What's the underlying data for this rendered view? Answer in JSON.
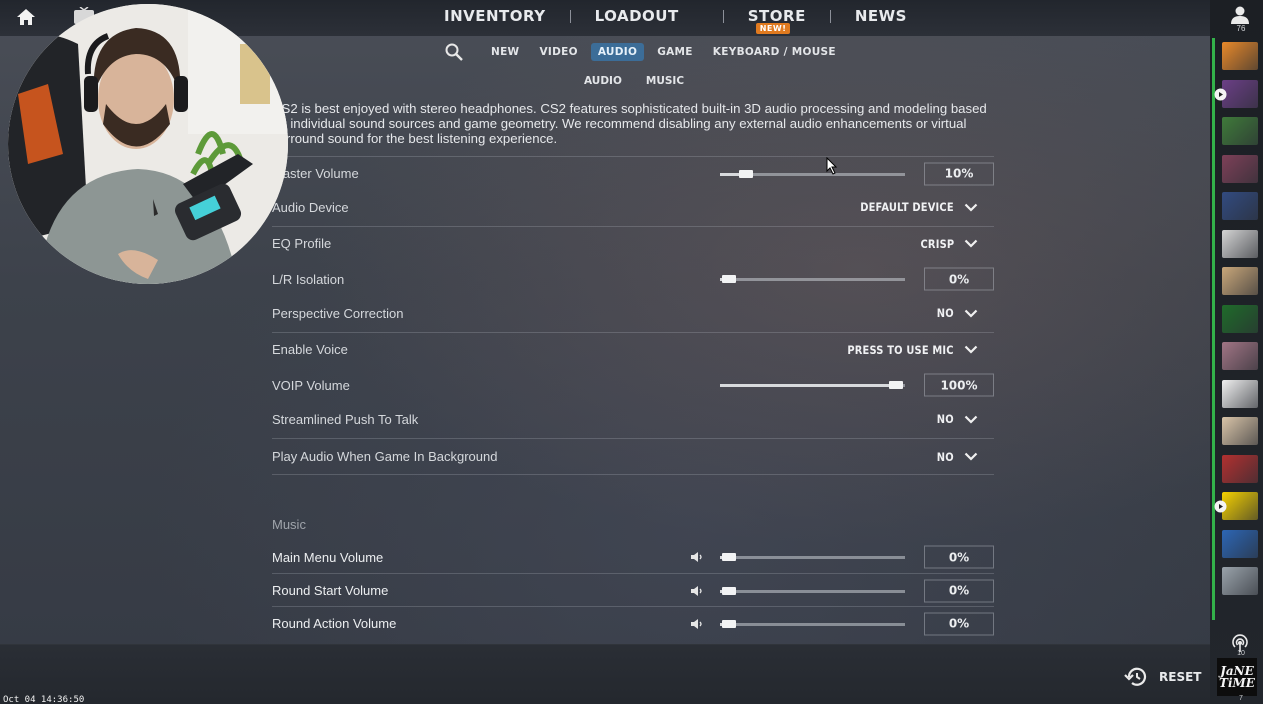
{
  "top_nav": {
    "items": [
      {
        "label": "INVENTORY"
      },
      {
        "label": "LOADOUT"
      },
      {
        "label": "STORE",
        "badge": "NEW!"
      },
      {
        "label": "NEWS"
      }
    ]
  },
  "sub_tabs": {
    "items": [
      {
        "label": "NEW",
        "active": false
      },
      {
        "label": "VIDEO",
        "active": false
      },
      {
        "label": "AUDIO",
        "active": true
      },
      {
        "label": "GAME",
        "active": false
      },
      {
        "label": "KEYBOARD / MOUSE",
        "active": false
      }
    ]
  },
  "sub_sub_tabs": {
    "items": [
      {
        "label": "AUDIO"
      },
      {
        "label": "MUSIC"
      }
    ]
  },
  "description": "CS2 is best enjoyed with stereo headphones. CS2 features sophisticated built-in 3D audio processing and modeling based on individual sound sources and game geometry. We recommend disabling any external audio enhancements or virtual surround sound for the best listening experience.",
  "audio_settings": [
    {
      "label": "Master Volume",
      "type": "slider",
      "value_text": "10%",
      "level": 0.1
    },
    {
      "label": "Audio Device",
      "type": "dropdown",
      "value_text": "DEFAULT DEVICE"
    },
    {
      "label": "EQ Profile",
      "type": "dropdown",
      "value_text": "CRISP"
    },
    {
      "label": "L/R Isolation",
      "type": "slider",
      "value_text": "0%",
      "level": 0
    },
    {
      "label": "Perspective Correction",
      "type": "dropdown",
      "value_text": "NO"
    },
    {
      "label": "Enable Voice",
      "type": "dropdown",
      "value_text": "PRESS TO USE MIC"
    },
    {
      "label": "VOIP Volume",
      "type": "slider",
      "value_text": "100%",
      "level": 1.0
    },
    {
      "label": "Streamlined Push To Talk",
      "type": "dropdown",
      "value_text": "NO"
    },
    {
      "label": "Play Audio When Game In Background",
      "type": "dropdown",
      "value_text": "NO"
    }
  ],
  "music_section": {
    "title": "Music",
    "settings": [
      {
        "label": "Main Menu Volume",
        "value_text": "0%",
        "level": 0
      },
      {
        "label": "Round Start Volume",
        "value_text": "0%",
        "level": 0
      },
      {
        "label": "Round Action Volume",
        "value_text": "0%",
        "level": 0
      }
    ]
  },
  "bottom_bar": {
    "reset_label": "RESET",
    "timestamp": "Oct 04 14:36:50"
  },
  "right_bar": {
    "online_count": "76",
    "signal_count": "10",
    "logo_line1": "JaNE",
    "logo_line2": "TiME",
    "bottom_count": "7",
    "friend_colors": [
      "#e8892a",
      "#6b3f86",
      "#3f7a3a",
      "#7d4058",
      "#324b80",
      "#d4d4d4",
      "#c9a77a",
      "#1f6b2a",
      "#a17585",
      "#f0f0f0",
      "#d9c4a8",
      "#b23030",
      "#f5d100",
      "#2c66b5",
      "#9aa3ab"
    ]
  },
  "colors": {
    "accent_tab": "#3c6d98",
    "online_green": "#33b24a",
    "store_badge": "#e07a1f"
  }
}
